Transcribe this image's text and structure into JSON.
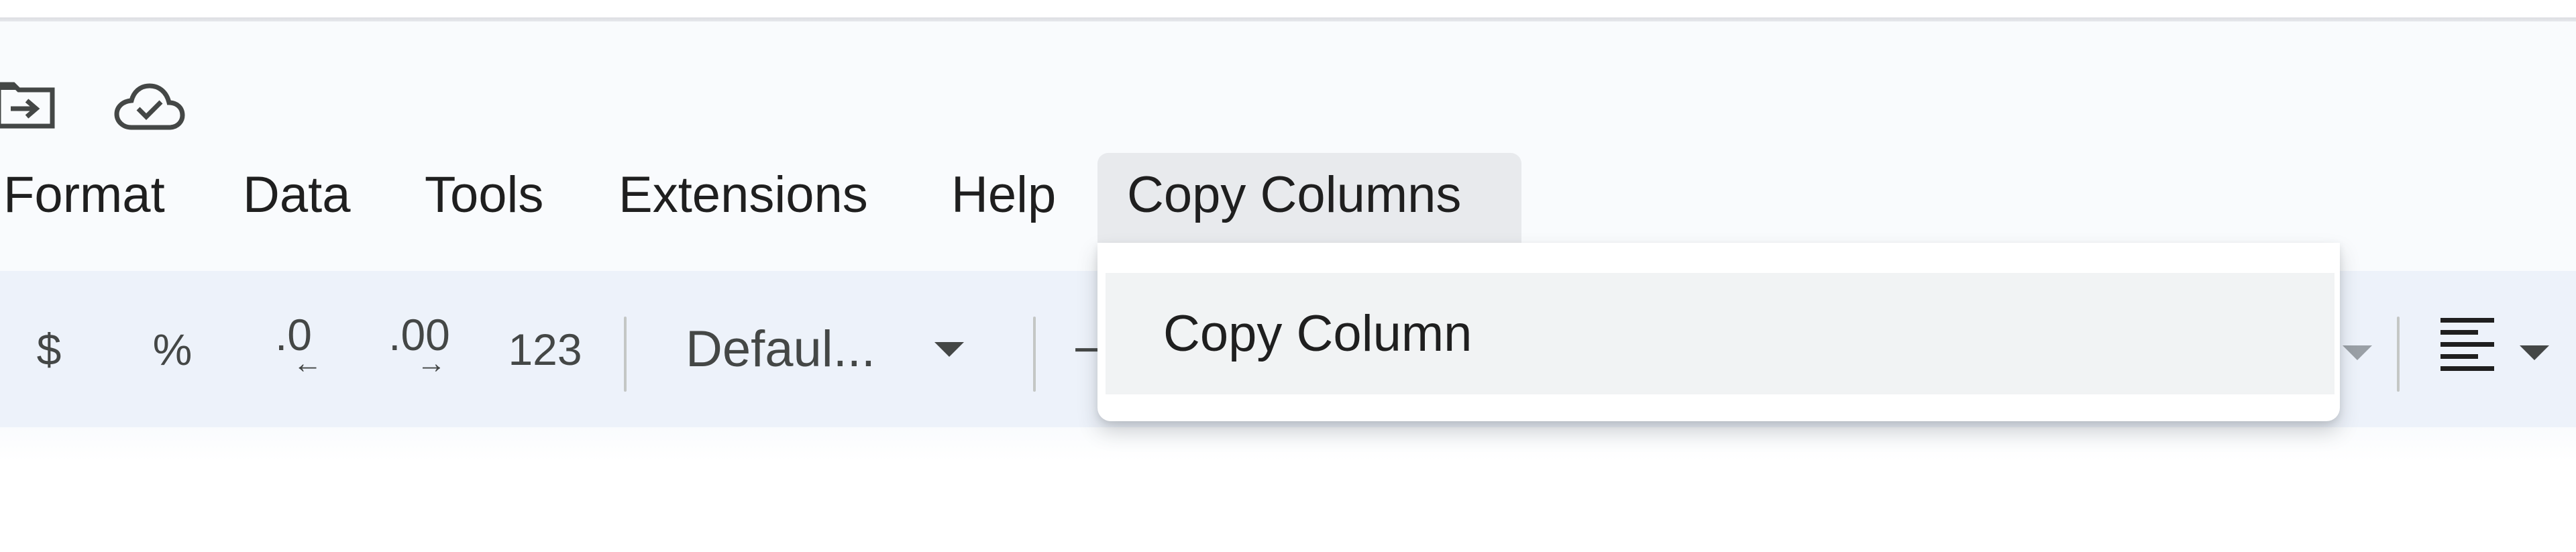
{
  "header": {
    "icons": [
      {
        "name": "move-to-folder-icon"
      },
      {
        "name": "cloud-saved-icon"
      }
    ]
  },
  "menubar": {
    "items": [
      {
        "label": "Format"
      },
      {
        "label": "Data"
      },
      {
        "label": "Tools"
      },
      {
        "label": "Extensions"
      },
      {
        "label": "Help"
      },
      {
        "label": "Copy Columns",
        "active": true
      }
    ]
  },
  "toolbar": {
    "currency": "$",
    "percent": "%",
    "decrease_decimal": ".0",
    "increase_decimal": ".00",
    "more_formats": "123",
    "font_family": "Defaul...",
    "font_size_partial": "−"
  },
  "dropdown": {
    "items": [
      {
        "label": "Copy Column"
      }
    ]
  },
  "colors": {
    "header_bg": "#f9fbfd",
    "toolbar_bg": "#edf2fa",
    "active_menu_bg": "#e8eaed",
    "menu_item_hover": "#f1f3f4"
  }
}
